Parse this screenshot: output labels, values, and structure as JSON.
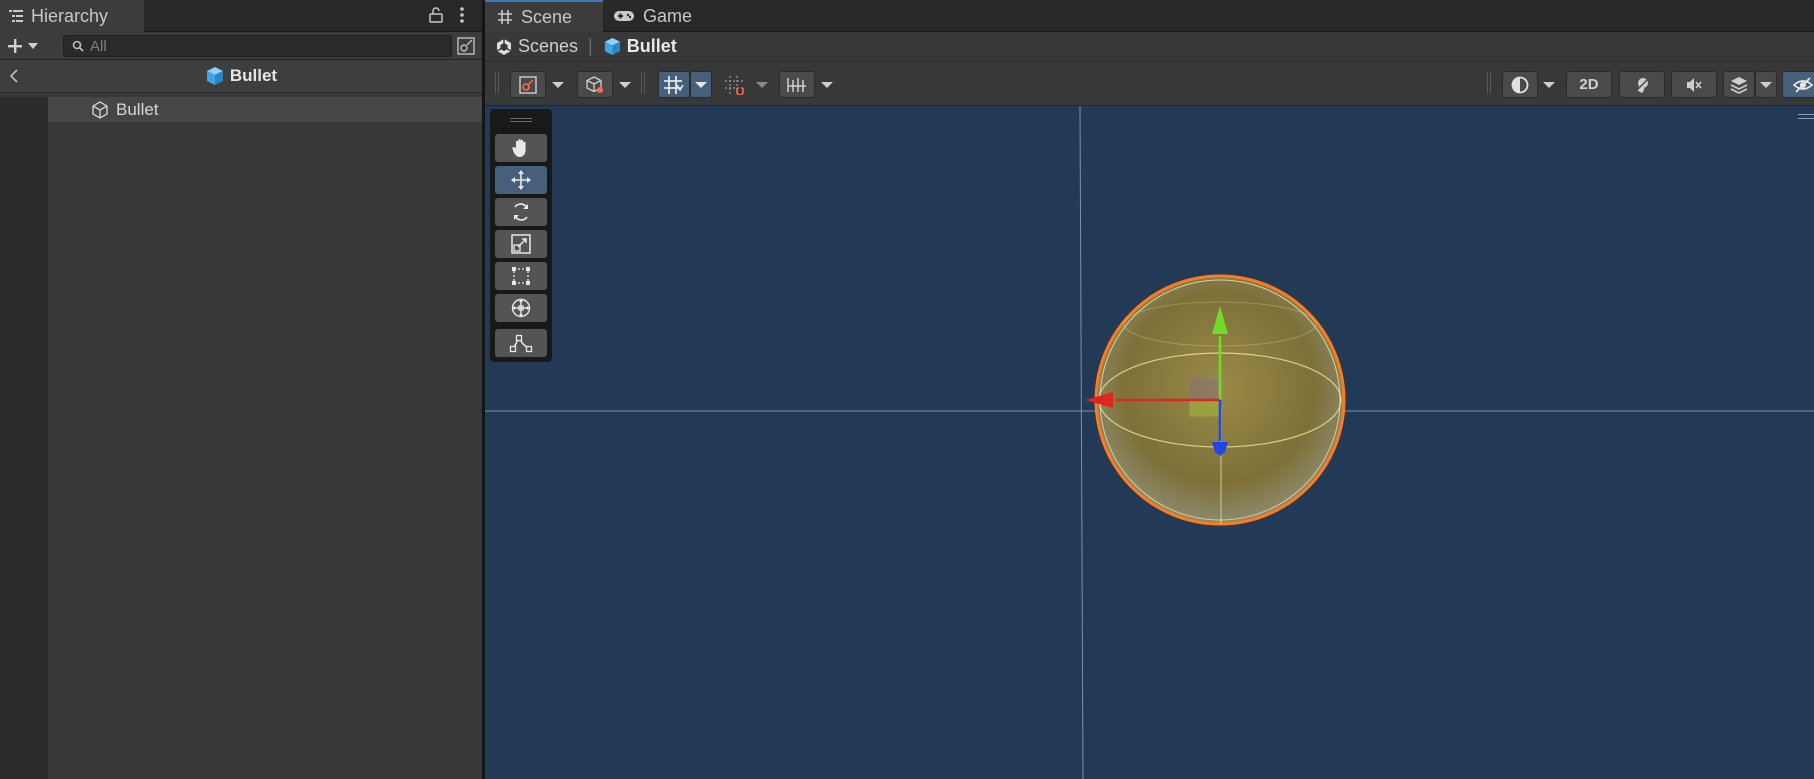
{
  "hierarchy": {
    "tab_label": "Hierarchy",
    "search": {
      "placeholder": "All",
      "value": ""
    },
    "prefab_title": "Bullet",
    "items": [
      {
        "label": "Bullet",
        "icon": "gameobject-cube-icon",
        "selected": false
      }
    ]
  },
  "scene_view": {
    "tabs": [
      {
        "label": "Scene",
        "icon": "grid-hash-icon",
        "active": true
      },
      {
        "label": "Game",
        "icon": "gamepad-icon",
        "active": false
      }
    ],
    "breadcrumb": [
      {
        "label": "Scenes",
        "icon": "unity-icon"
      },
      {
        "label": "Bullet",
        "icon": "prefab-cube-icon"
      }
    ],
    "toolbar": {
      "mode_2d_label": "2D",
      "grid_snap_active": true
    },
    "tools": [
      {
        "name": "hand-tool",
        "active": false
      },
      {
        "name": "move-tool",
        "active": true
      },
      {
        "name": "rotate-tool",
        "active": false
      },
      {
        "name": "scale-tool",
        "active": false
      },
      {
        "name": "rect-tool",
        "active": false
      },
      {
        "name": "transform-tool",
        "active": false
      },
      {
        "name": "custom-tool",
        "active": false
      }
    ]
  },
  "colors": {
    "scene_background": "#223a55",
    "panel_background": "#383838",
    "selection_outline": "#ff7a1a",
    "axis_x": "#e0271f",
    "axis_y": "#6fdc2a",
    "axis_z": "#2147e6",
    "sphere": "#8a7a3a",
    "accent_blue": "#46607c"
  }
}
